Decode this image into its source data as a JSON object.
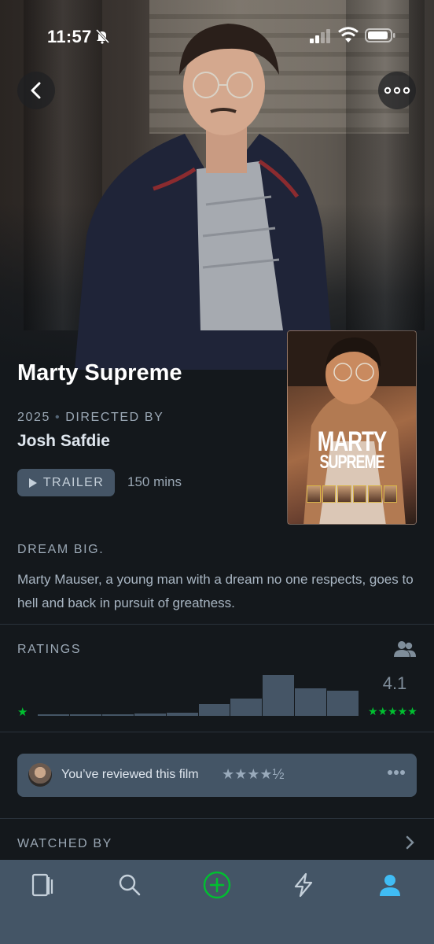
{
  "status_bar": {
    "time": "11:57"
  },
  "film": {
    "title": "Marty Supreme",
    "year": "2025",
    "directed_by_label": "DIRECTED BY",
    "director": "Josh Safdie",
    "trailer_label": "TRAILER",
    "runtime": "150 mins",
    "poster_title_line1": "MARTY",
    "poster_title_line2": "SUPREME"
  },
  "tagline": "DREAM BIG.",
  "synopsis": "Marty Mauser, a young man with a dream no one respects, goes to hell and back in pursuit of greatness.",
  "ratings": {
    "label": "RATINGS",
    "average": "4.1",
    "histogram_fraction": [
      0.03,
      0.03,
      0.03,
      0.05,
      0.07,
      0.28,
      0.42,
      1.0,
      0.68,
      0.62
    ],
    "low_star": "★",
    "high_stars": "★★★★★",
    "star_color": "#00c030"
  },
  "review": {
    "text": "You’ve reviewed this film",
    "stars": "★★★★½"
  },
  "watched_by": {
    "label": "WATCHED BY"
  },
  "colors": {
    "accent_green": "#00c030",
    "accent_blue": "#40bcf4",
    "tab_bar": "#445566"
  },
  "tabs": [
    {
      "name": "films",
      "icon": "films-icon"
    },
    {
      "name": "search",
      "icon": "search-icon"
    },
    {
      "name": "add",
      "icon": "add-circle-icon"
    },
    {
      "name": "activity",
      "icon": "lightning-icon"
    },
    {
      "name": "profile",
      "icon": "profile-icon",
      "active": true
    }
  ]
}
